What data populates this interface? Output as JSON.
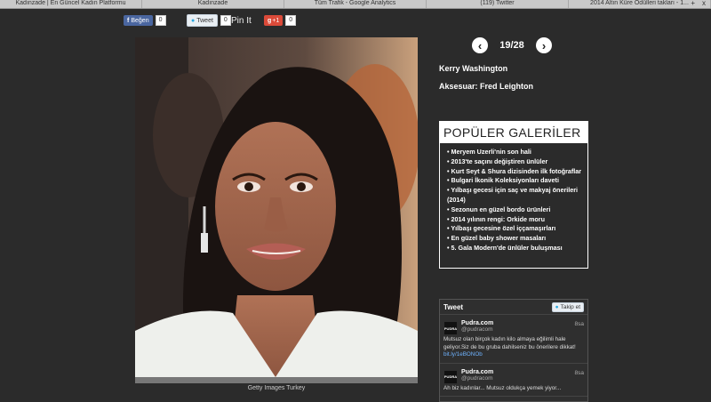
{
  "browser": {
    "tabs": [
      "Kadınzade | En Güncel Kadın Platformu",
      "Kadınzade",
      "Tüm Trafik - Google Analytics",
      "(119) Twitter",
      "2014 Altın Küre Ödülleri takları - 1..."
    ],
    "close_symbol": "x",
    "plus_symbol": "+"
  },
  "share": {
    "facebook_label": "Beğen",
    "facebook_count": "0",
    "tweet_label": "Tweet",
    "tweet_count": "0",
    "pinit_label": "Pin It",
    "gplus_label": "+1",
    "gplus_count": "0"
  },
  "gallery": {
    "counter": "19/28",
    "person": "Kerry Washington",
    "accessory": "Aksesuar: Fred Leighton",
    "photo_credit": "Getty Images Turkey"
  },
  "popular": {
    "title": "POPÜLER GALERİLER",
    "items": [
      "Meryem Uzerli'nin son hali",
      "2013'te saçını değiştiren ünlüler",
      "Kurt Seyt & Shura dizisinden ilk fotoğraflar",
      "Bulgari İkonik Koleksiyonları daveti",
      "Yılbaşı gecesi için saç ve makyaj önerileri (2014)",
      "Sezonun en güzel bordo ürünleri",
      "2014 yılının rengi: Orkide moru",
      "Yılbaşı gecesine özel iççamaşırları",
      "En güzel baby shower masaları",
      "5. Gala Modern'de ünlüler buluşması"
    ]
  },
  "twitter": {
    "title": "Tweet",
    "follow_label": "Takip et",
    "avatar_text": "PUDRA",
    "tweets": [
      {
        "name": "Pudra.com",
        "handle": "@pudracom",
        "time": "8sa",
        "text": "Mutsuz olan birçok kadın kilo almaya eğilimli hale geliyor.Siz de bu gruba dahilseniz bu önerilere dikkat!",
        "link": "bit.ly/1eBONOb"
      },
      {
        "name": "Pudra.com",
        "handle": "@pudracom",
        "time": "8sa",
        "text": "Ah biz kadınlar... Mutsuz oldukça yemek yiyor...",
        "link": ""
      }
    ]
  },
  "colors": {
    "background": "#2b2b2b",
    "facebook": "#4a66a0",
    "gplus": "#db4a39",
    "link": "#6fb3ff"
  }
}
